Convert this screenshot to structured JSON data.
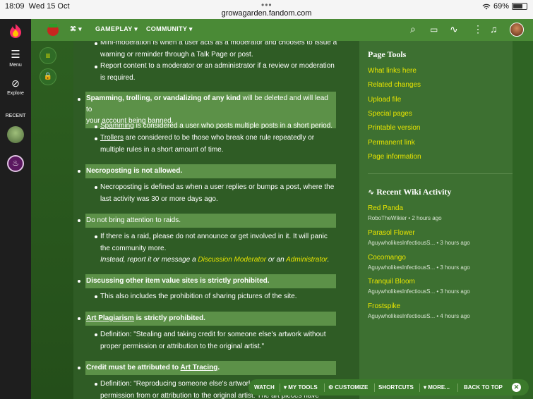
{
  "status": {
    "time": "18:09",
    "date": "Wed 15 Oct",
    "url": "growagarden.fandom.com",
    "battery": "69%"
  },
  "rail": {
    "menu": "Menu",
    "explore": "Explore",
    "recent": "RECENT"
  },
  "nav": {
    "gameplay": "GAMEPLAY",
    "community": "COMMUNITY"
  },
  "article": {
    "mini_mod_a": "Mini-moderation is when a user acts as a moderator and chooses to issue a",
    "mini_mod_b": "warning or reminder through a Talk Page or post.",
    "report_a": "Report content to a moderator or an administrator if a review or moderation",
    "report_b": "is required.",
    "spam_bold": "Spamming, trolling, or vandalizing of any kind",
    "spam_rest": " will be deleted and will lead to",
    "spam_line2": "your account being banned.",
    "spamming_link": "Spamming",
    "spamming_rest": " is considered a user who posts multiple posts in a short period.",
    "trollers_link": "Trollers",
    "trollers_rest": " are considered to be those who break one rule repeatedly or",
    "trollers_line2": "multiple rules in a short amount of time.",
    "necro_head": "Necroposting is not allowed.",
    "necro_a": "Necroposting is defined as when a user replies or bumps a post, where the",
    "necro_b": "last activity was 30 or more days ago.",
    "raids_head": "Do not bring attention to raids.",
    "raids_a": "If there is a raid, please do not announce or get involved in it. It will panic",
    "raids_b": "the community more.",
    "raids_c1": "Instead, report it or message a ",
    "raids_c_link1": "Discussion Moderator",
    "raids_c2": " or an ",
    "raids_c_link2": "Administrator",
    "raids_c3": ".",
    "values_head": "Discussing other item value sites is strictly prohibited.",
    "values_a": "This also includes the prohibition of sharing pictures of the site.",
    "plag_link": "Art Plagiarism",
    "plag_rest": " is strictly prohibited.",
    "plag_a": "Definition: \"Stealing and taking credit for someone else's artwork without",
    "plag_b": "proper permission or attribution to the original artist.\"",
    "credit_head": "Credit must be attributed to ",
    "credit_link": "Art Tracing",
    "credit_dot": ".",
    "trace_a": "Definition: \"Reproducing someone else's artwork",
    "trace_b": "permission from or attribution to the original artist. The art pieces have"
  },
  "sidebar": {
    "page_tools_title": "Page Tools",
    "tools": [
      "What links here",
      "Related changes",
      "Upload file",
      "Special pages",
      "Printable version",
      "Permanent link",
      "Page information"
    ],
    "activity_title": "Recent Wiki Activity",
    "activity": [
      {
        "title": "Red Panda",
        "meta": "RoboTheWikier • 2 hours ago"
      },
      {
        "title": "Parasol Flower",
        "meta": "AguywholikesInfectiousS... • 3 hours ago"
      },
      {
        "title": "Cocomango",
        "meta": "AguywholikesInfectiousS... • 3 hours ago"
      },
      {
        "title": "Tranquil Bloom",
        "meta": "AguywholikesInfectiousS... • 3 hours ago"
      },
      {
        "title": "Frostspike",
        "meta": "AguywholikesInfectiousS... • 4 hours ago"
      }
    ]
  },
  "toolbar": {
    "watch": "WATCH",
    "my_tools": "MY TOOLS",
    "customize": "CUSTOMIZE",
    "shortcuts": "SHORTCUTS",
    "more": "MORE...",
    "back_to_top": "BACK TO TOP"
  },
  "colors": {
    "accent_yellow": "#e7e400",
    "nav_green": "#4a8a36",
    "highlight_green": "#5c9148"
  }
}
